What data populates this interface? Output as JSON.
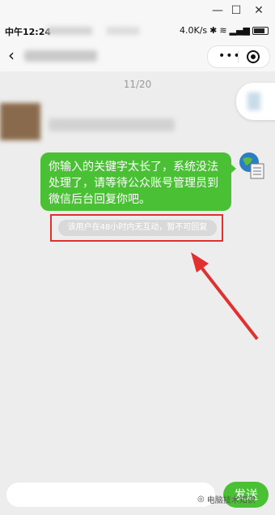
{
  "window": {
    "minimize_icon": "—",
    "maximize_icon": "☐",
    "close_icon": "✕"
  },
  "status": {
    "time": "中午12:24",
    "net_speed": "4.0K/s",
    "battery_level": 0.8
  },
  "nav": {
    "back_icon": "‹",
    "menu_dots": "•••"
  },
  "chat": {
    "date": "11/20",
    "reply": "你输入的关键字太长了，系统没法处理了，请等待公众账号管理员到微信后台回复你吧。",
    "notice": "该用户在48小时内无互动，暂不可回复"
  },
  "composer": {
    "send_label": "发送"
  },
  "watermark": {
    "text": "电脑技术知识"
  },
  "colors": {
    "accent": "#4ac035",
    "annotation": "#e0302f"
  }
}
